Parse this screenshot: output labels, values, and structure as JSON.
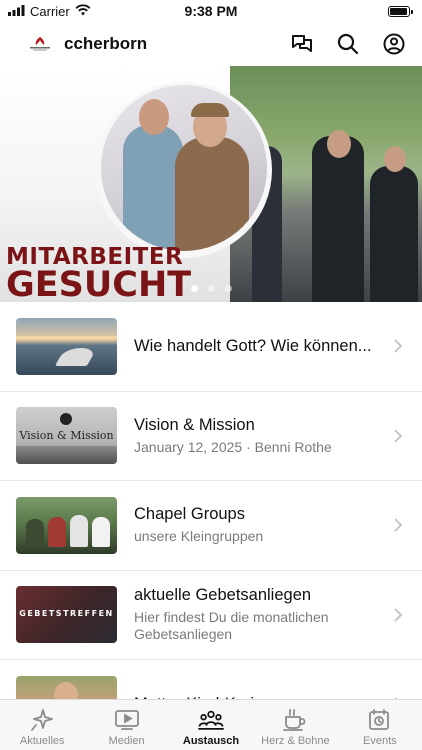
{
  "status_bar": {
    "carrier": "Carrier",
    "time": "9:38 PM",
    "battery_level": 0.95
  },
  "header": {
    "title": "ccherborn",
    "icons": [
      "logo",
      "chat-bubbles-icon",
      "search-icon",
      "profile-icon"
    ]
  },
  "hero": {
    "line1": "MITARBEITER",
    "line2": "GESUCHT",
    "page_count": 3,
    "active_page": 1,
    "text_color": "#7b1416"
  },
  "list": {
    "items": [
      {
        "title": "Wie handelt Gott? Wie können...",
        "subtitle": "",
        "thumb_text": ""
      },
      {
        "title": "Vision & Mission",
        "subtitle": "January 12, 2025 · Benni Rothe",
        "thumb_text": "Vision & Mission"
      },
      {
        "title": "Chapel Groups",
        "subtitle": "unsere Kleingruppen",
        "thumb_text": ""
      },
      {
        "title": "aktuelle Gebetsanliegen",
        "subtitle": "Hier findest Du die monatlichen Gebetsanliegen",
        "thumb_text": "GEBETSTREFFEN"
      },
      {
        "title": "Mutter-Kind-Kreis",
        "subtitle": "",
        "thumb_text": ""
      }
    ]
  },
  "tabbar": {
    "tabs": [
      {
        "label": "Aktuelles",
        "icon": "sparkle-icon"
      },
      {
        "label": "Medien",
        "icon": "play-screen-icon"
      },
      {
        "label": "Austausch",
        "icon": "group-icon",
        "active": true
      },
      {
        "label": "Herz & Bohne",
        "icon": "coffee-cup-icon"
      },
      {
        "label": "Events",
        "icon": "calendar-clock-icon"
      }
    ]
  },
  "colors": {
    "accent": "#7b1416",
    "text": "#111111",
    "muted": "#7b7b7b",
    "tab_inactive": "#8b8b8b"
  }
}
